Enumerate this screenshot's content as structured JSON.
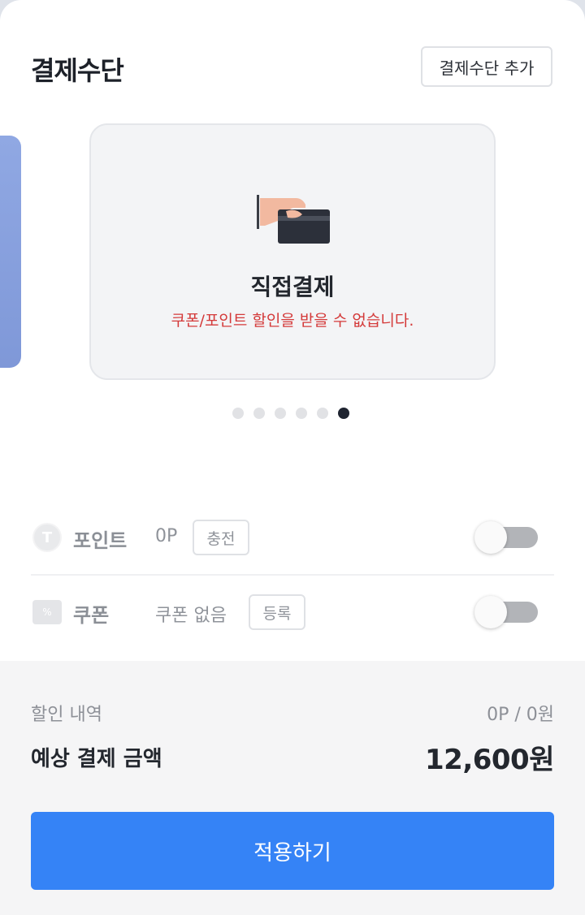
{
  "header": {
    "title": "결제수단",
    "add_button": "결제수단 추가"
  },
  "carousel": {
    "active_card": {
      "title": "직접결제",
      "notice": "쿠폰/포인트 할인을 받을 수 없습니다."
    },
    "page_count": 6,
    "active_index": 5
  },
  "point": {
    "icon_glyph": "T",
    "label": "포인트",
    "value": "0P",
    "button": "충전",
    "toggle_on": false
  },
  "coupon": {
    "icon_glyph": "%",
    "label": "쿠폰",
    "value": "쿠폰 없음",
    "button": "등록",
    "toggle_on": false
  },
  "summary": {
    "discount_label": "할인 내역",
    "discount_value": "0P / 0원",
    "total_label": "예상 결제 금액",
    "total_value": "12,600원"
  },
  "apply_button": "적용하기",
  "colors": {
    "primary": "#3583f6",
    "notice": "#d43a3a",
    "prev_card": "#8aa2e0"
  }
}
